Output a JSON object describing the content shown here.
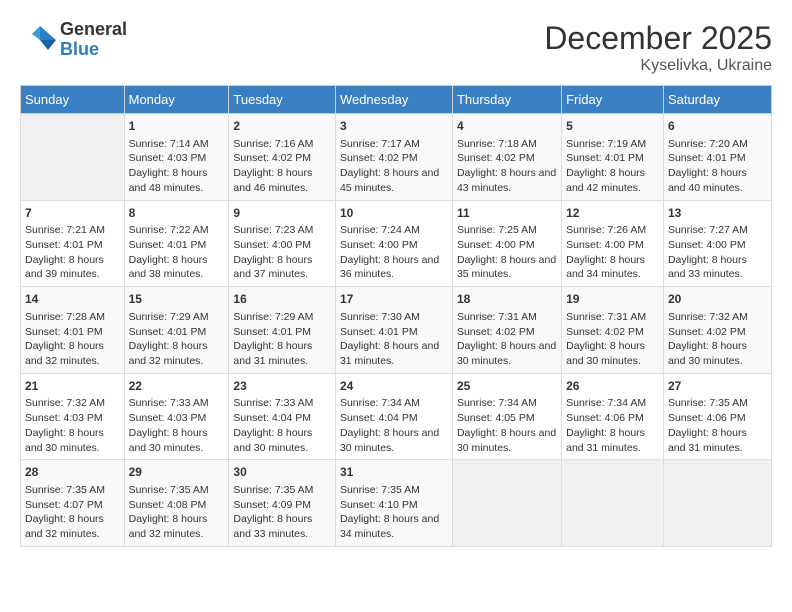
{
  "logo": {
    "general": "General",
    "blue": "Blue"
  },
  "title": "December 2025",
  "subtitle": "Kyselivka, Ukraine",
  "days_of_week": [
    "Sunday",
    "Monday",
    "Tuesday",
    "Wednesday",
    "Thursday",
    "Friday",
    "Saturday"
  ],
  "weeks": [
    [
      {
        "day": "",
        "sunrise": "",
        "sunset": "",
        "daylight": ""
      },
      {
        "day": "1",
        "sunrise": "Sunrise: 7:14 AM",
        "sunset": "Sunset: 4:03 PM",
        "daylight": "Daylight: 8 hours and 48 minutes."
      },
      {
        "day": "2",
        "sunrise": "Sunrise: 7:16 AM",
        "sunset": "Sunset: 4:02 PM",
        "daylight": "Daylight: 8 hours and 46 minutes."
      },
      {
        "day": "3",
        "sunrise": "Sunrise: 7:17 AM",
        "sunset": "Sunset: 4:02 PM",
        "daylight": "Daylight: 8 hours and 45 minutes."
      },
      {
        "day": "4",
        "sunrise": "Sunrise: 7:18 AM",
        "sunset": "Sunset: 4:02 PM",
        "daylight": "Daylight: 8 hours and 43 minutes."
      },
      {
        "day": "5",
        "sunrise": "Sunrise: 7:19 AM",
        "sunset": "Sunset: 4:01 PM",
        "daylight": "Daylight: 8 hours and 42 minutes."
      },
      {
        "day": "6",
        "sunrise": "Sunrise: 7:20 AM",
        "sunset": "Sunset: 4:01 PM",
        "daylight": "Daylight: 8 hours and 40 minutes."
      }
    ],
    [
      {
        "day": "7",
        "sunrise": "Sunrise: 7:21 AM",
        "sunset": "Sunset: 4:01 PM",
        "daylight": "Daylight: 8 hours and 39 minutes."
      },
      {
        "day": "8",
        "sunrise": "Sunrise: 7:22 AM",
        "sunset": "Sunset: 4:01 PM",
        "daylight": "Daylight: 8 hours and 38 minutes."
      },
      {
        "day": "9",
        "sunrise": "Sunrise: 7:23 AM",
        "sunset": "Sunset: 4:00 PM",
        "daylight": "Daylight: 8 hours and 37 minutes."
      },
      {
        "day": "10",
        "sunrise": "Sunrise: 7:24 AM",
        "sunset": "Sunset: 4:00 PM",
        "daylight": "Daylight: 8 hours and 36 minutes."
      },
      {
        "day": "11",
        "sunrise": "Sunrise: 7:25 AM",
        "sunset": "Sunset: 4:00 PM",
        "daylight": "Daylight: 8 hours and 35 minutes."
      },
      {
        "day": "12",
        "sunrise": "Sunrise: 7:26 AM",
        "sunset": "Sunset: 4:00 PM",
        "daylight": "Daylight: 8 hours and 34 minutes."
      },
      {
        "day": "13",
        "sunrise": "Sunrise: 7:27 AM",
        "sunset": "Sunset: 4:00 PM",
        "daylight": "Daylight: 8 hours and 33 minutes."
      }
    ],
    [
      {
        "day": "14",
        "sunrise": "Sunrise: 7:28 AM",
        "sunset": "Sunset: 4:01 PM",
        "daylight": "Daylight: 8 hours and 32 minutes."
      },
      {
        "day": "15",
        "sunrise": "Sunrise: 7:29 AM",
        "sunset": "Sunset: 4:01 PM",
        "daylight": "Daylight: 8 hours and 32 minutes."
      },
      {
        "day": "16",
        "sunrise": "Sunrise: 7:29 AM",
        "sunset": "Sunset: 4:01 PM",
        "daylight": "Daylight: 8 hours and 31 minutes."
      },
      {
        "day": "17",
        "sunrise": "Sunrise: 7:30 AM",
        "sunset": "Sunset: 4:01 PM",
        "daylight": "Daylight: 8 hours and 31 minutes."
      },
      {
        "day": "18",
        "sunrise": "Sunrise: 7:31 AM",
        "sunset": "Sunset: 4:02 PM",
        "daylight": "Daylight: 8 hours and 30 minutes."
      },
      {
        "day": "19",
        "sunrise": "Sunrise: 7:31 AM",
        "sunset": "Sunset: 4:02 PM",
        "daylight": "Daylight: 8 hours and 30 minutes."
      },
      {
        "day": "20",
        "sunrise": "Sunrise: 7:32 AM",
        "sunset": "Sunset: 4:02 PM",
        "daylight": "Daylight: 8 hours and 30 minutes."
      }
    ],
    [
      {
        "day": "21",
        "sunrise": "Sunrise: 7:32 AM",
        "sunset": "Sunset: 4:03 PM",
        "daylight": "Daylight: 8 hours and 30 minutes."
      },
      {
        "day": "22",
        "sunrise": "Sunrise: 7:33 AM",
        "sunset": "Sunset: 4:03 PM",
        "daylight": "Daylight: 8 hours and 30 minutes."
      },
      {
        "day": "23",
        "sunrise": "Sunrise: 7:33 AM",
        "sunset": "Sunset: 4:04 PM",
        "daylight": "Daylight: 8 hours and 30 minutes."
      },
      {
        "day": "24",
        "sunrise": "Sunrise: 7:34 AM",
        "sunset": "Sunset: 4:04 PM",
        "daylight": "Daylight: 8 hours and 30 minutes."
      },
      {
        "day": "25",
        "sunrise": "Sunrise: 7:34 AM",
        "sunset": "Sunset: 4:05 PM",
        "daylight": "Daylight: 8 hours and 30 minutes."
      },
      {
        "day": "26",
        "sunrise": "Sunrise: 7:34 AM",
        "sunset": "Sunset: 4:06 PM",
        "daylight": "Daylight: 8 hours and 31 minutes."
      },
      {
        "day": "27",
        "sunrise": "Sunrise: 7:35 AM",
        "sunset": "Sunset: 4:06 PM",
        "daylight": "Daylight: 8 hours and 31 minutes."
      }
    ],
    [
      {
        "day": "28",
        "sunrise": "Sunrise: 7:35 AM",
        "sunset": "Sunset: 4:07 PM",
        "daylight": "Daylight: 8 hours and 32 minutes."
      },
      {
        "day": "29",
        "sunrise": "Sunrise: 7:35 AM",
        "sunset": "Sunset: 4:08 PM",
        "daylight": "Daylight: 8 hours and 32 minutes."
      },
      {
        "day": "30",
        "sunrise": "Sunrise: 7:35 AM",
        "sunset": "Sunset: 4:09 PM",
        "daylight": "Daylight: 8 hours and 33 minutes."
      },
      {
        "day": "31",
        "sunrise": "Sunrise: 7:35 AM",
        "sunset": "Sunset: 4:10 PM",
        "daylight": "Daylight: 8 hours and 34 minutes."
      },
      {
        "day": "",
        "sunrise": "",
        "sunset": "",
        "daylight": ""
      },
      {
        "day": "",
        "sunrise": "",
        "sunset": "",
        "daylight": ""
      },
      {
        "day": "",
        "sunrise": "",
        "sunset": "",
        "daylight": ""
      }
    ]
  ]
}
